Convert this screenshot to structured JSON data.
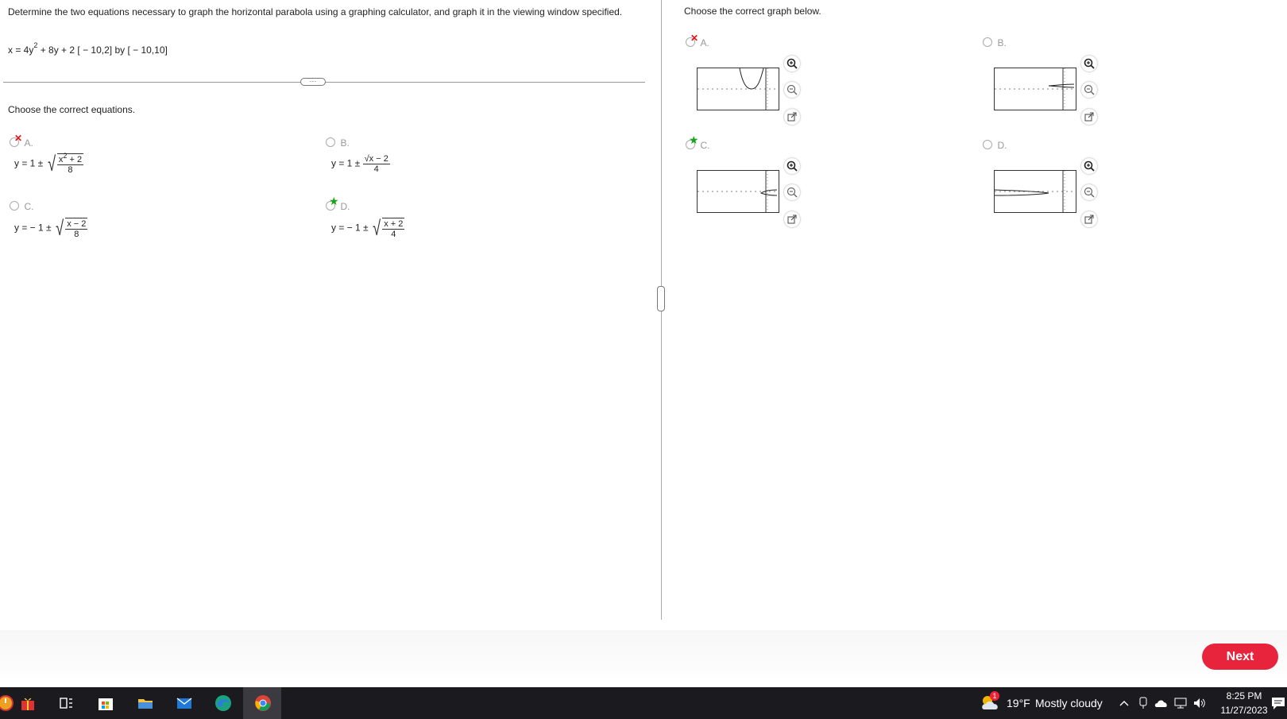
{
  "question": {
    "instruction": "Determine the two equations necessary to graph the horizontal parabola using a graphing calculator, and graph it in the viewing window specified.",
    "equation_prefix": "x = 4y",
    "equation_exp": "2",
    "equation_rest": " + 8y + 2  [ − 10,2] by [ − 10,10]",
    "more_label": "···"
  },
  "left": {
    "prompt": "Choose the correct equations.",
    "options": [
      {
        "letter": "A.",
        "prefix": "y = 1 ±",
        "num_a": "x",
        "num_exp": "2",
        "num_b": " + 2",
        "den": "8",
        "state": "incorrect"
      },
      {
        "letter": "B.",
        "prefix": "y = 1 ±",
        "num": "√x − 2",
        "den": "4",
        "state": "unselected"
      },
      {
        "letter": "C.",
        "prefix": "y = − 1 ±",
        "num": "x − 2",
        "den": "8",
        "state": "unselected"
      },
      {
        "letter": "D.",
        "prefix": "y = − 1 ±",
        "num": "x + 2",
        "den": "4",
        "state": "correct"
      }
    ]
  },
  "right": {
    "prompt": "Choose the correct graph below.",
    "options": [
      {
        "letter": "A.",
        "state": "incorrect"
      },
      {
        "letter": "B.",
        "state": "unselected"
      },
      {
        "letter": "C.",
        "state": "correct"
      },
      {
        "letter": "D.",
        "state": "unselected"
      }
    ]
  },
  "footer": {
    "next_label": "Next"
  },
  "taskbar": {
    "weather_temp": "19°F",
    "weather_desc": "Mostly cloudy",
    "weather_badge": "1",
    "time": "8:25 PM",
    "date": "11/27/2023"
  },
  "colors": {
    "incorrect": "#e0161b",
    "correct": "#1aa31a",
    "next": "#e8243c",
    "taskbar": "#1b1b1f"
  }
}
